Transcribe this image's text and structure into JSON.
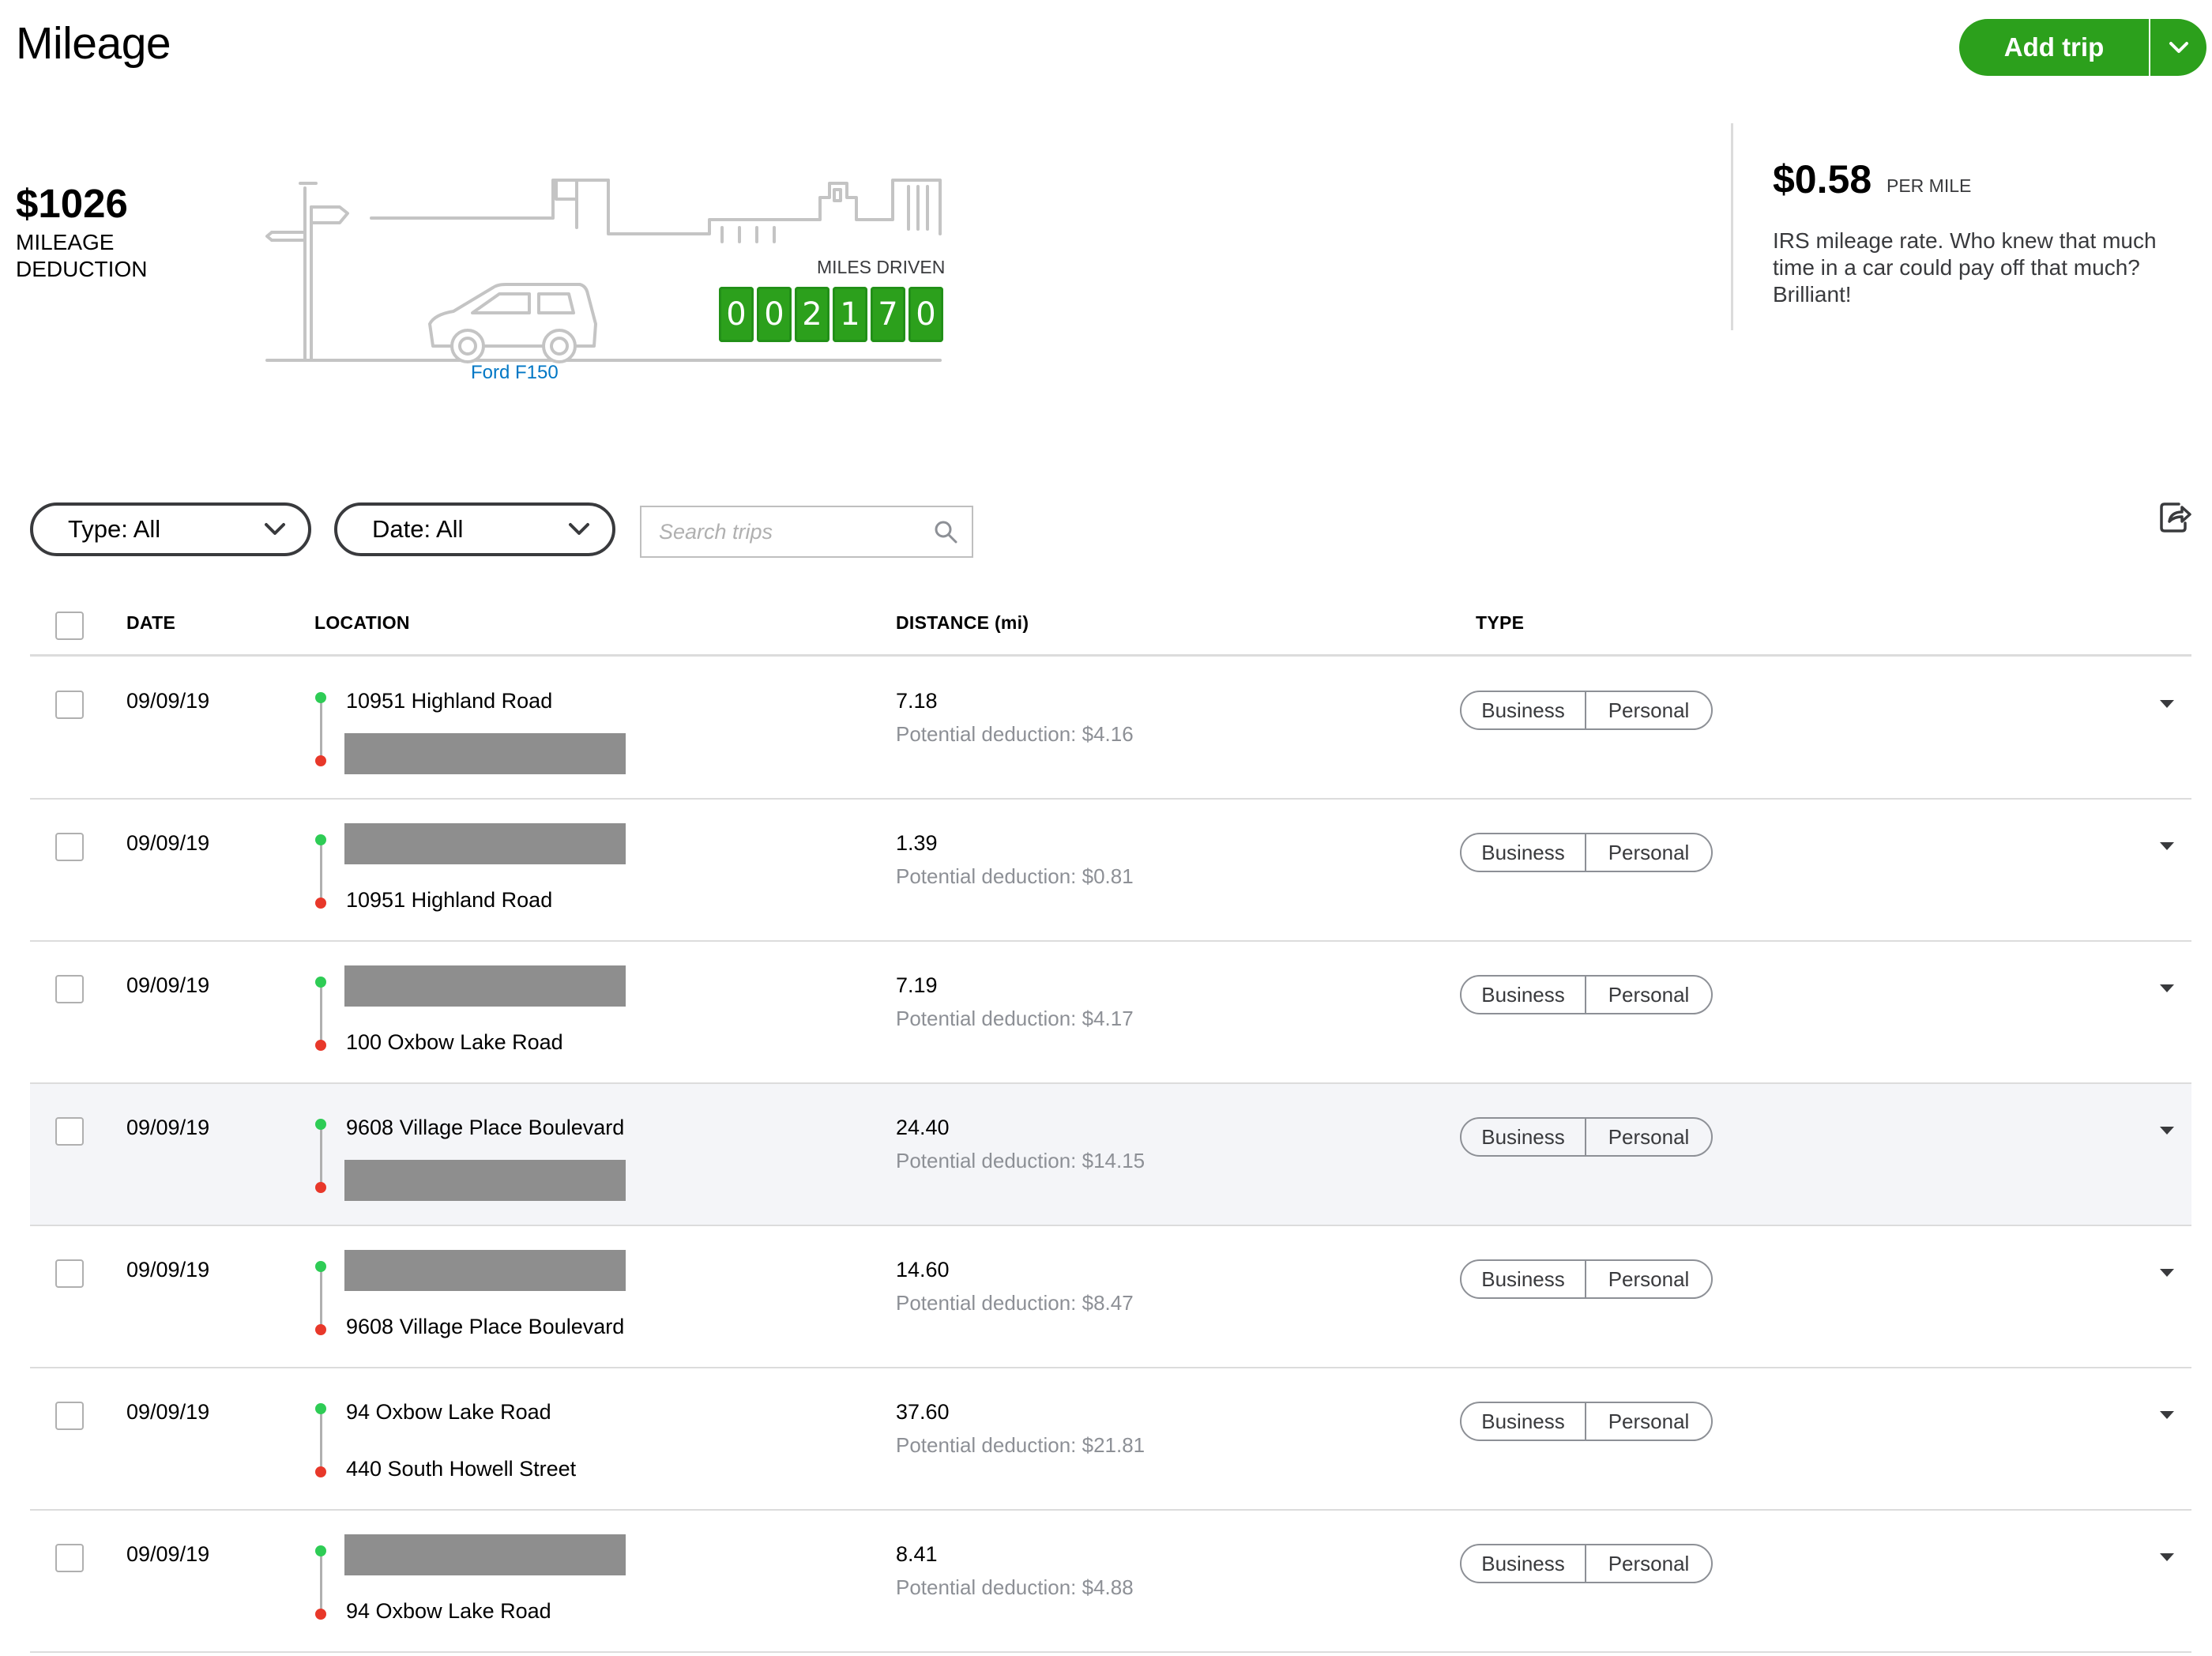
{
  "header": {
    "title": "Mileage",
    "add_trip_label": "Add trip"
  },
  "summary": {
    "deduction_amount": "$1026",
    "deduction_label": "MILEAGE DEDUCTION",
    "vehicle_name": "Ford F150",
    "miles_driven_label": "MILES DRIVEN",
    "odometer_digits": [
      "0",
      "0",
      "2",
      "1",
      "7",
      "0"
    ],
    "rate_amount": "$0.58",
    "rate_suffix": "PER MILE",
    "rate_description": "IRS mileage rate. Who knew that much time in a car could pay off that much? Brilliant!"
  },
  "filters": {
    "type_label": "Type: All",
    "date_label": "Date: All",
    "search_placeholder": "Search trips"
  },
  "table": {
    "columns": [
      "DATE",
      "LOCATION",
      "DISTANCE (mi)",
      "TYPE"
    ],
    "type_options": [
      "Business",
      "Personal"
    ],
    "rows": [
      {
        "date": "09/09/19",
        "start": "10951 Highland Road",
        "end": null,
        "distance": "7.18",
        "deduction": "Potential deduction: $4.16",
        "highlight": false
      },
      {
        "date": "09/09/19",
        "start": null,
        "end": "10951 Highland Road",
        "distance": "1.39",
        "deduction": "Potential deduction: $0.81",
        "highlight": false
      },
      {
        "date": "09/09/19",
        "start": null,
        "end": "100 Oxbow Lake Road",
        "distance": "7.19",
        "deduction": "Potential deduction: $4.17",
        "highlight": false
      },
      {
        "date": "09/09/19",
        "start": "9608 Village Place Boulevard",
        "end": null,
        "distance": "24.40",
        "deduction": "Potential deduction: $14.15",
        "highlight": true
      },
      {
        "date": "09/09/19",
        "start": null,
        "end": "9608 Village Place Boulevard",
        "distance": "14.60",
        "deduction": "Potential deduction: $8.47",
        "highlight": false
      },
      {
        "date": "09/09/19",
        "start": "94 Oxbow Lake Road",
        "end": "440 South Howell Street",
        "distance": "37.60",
        "deduction": "Potential deduction: $21.81",
        "highlight": false
      },
      {
        "date": "09/09/19",
        "start": null,
        "end": "94 Oxbow Lake Road",
        "distance": "8.41",
        "deduction": "Potential deduction: $4.88",
        "highlight": false
      }
    ]
  },
  "colors": {
    "brand_green": "#2ca01c",
    "link_blue": "#0077c5",
    "start_dot": "#2ecc55",
    "end_dot": "#e8382a",
    "redaction_gray": "#8e8e8e"
  },
  "icons": [
    "chevron-down-icon",
    "search-icon",
    "export-icon",
    "caret-down-icon",
    "signpost-icon",
    "car-icon"
  ]
}
